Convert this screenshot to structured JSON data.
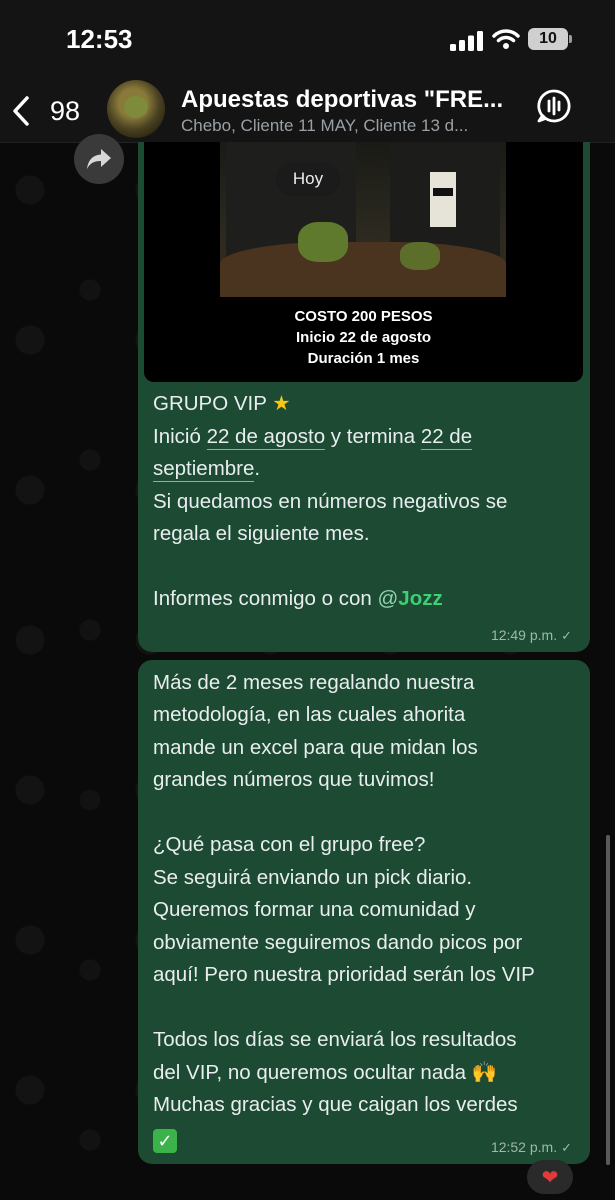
{
  "status_bar": {
    "time": "12:53",
    "battery": "10"
  },
  "header": {
    "back_count": "98",
    "title": "Apuestas deportivas  \"FRE...",
    "subtitle": "Chebo, Cliente 11 MAY, Cliente 13 d..."
  },
  "day_divider": "Hoy",
  "message1": {
    "media_lines": [
      "COSTO 200 PESOS",
      "Inicio 22 de agosto",
      "Duración 1 mes"
    ],
    "line1": "GRUPO VIP",
    "line1_emoji": "★",
    "line2_pre": "Inició ",
    "line2_link1": "22 de agosto",
    "line2_mid": " y termina ",
    "line2_link2": "22 de",
    "line3_link": "septiembre",
    "line3_post": ".",
    "line4": "Si quedamos en números negativos se",
    "line5": "regala el siguiente mes.",
    "line6_pre": "Informes conmigo o con ",
    "mention_at": "@",
    "mention_name": "Jozz",
    "time": "12:49 p.m.",
    "status_icon": "✓"
  },
  "message2": {
    "lines": [
      "Más de 2 meses regalando nuestra",
      "metodología, en las cuales ahorita",
      "mande un excel para que midan los",
      "grandes números que tuvimos!",
      "",
      "¿Qué pasa con el grupo free?",
      "Se seguirá enviando un pick diario.",
      "Queremos formar una comunidad y",
      "obviamente seguiremos dando picos por",
      "aquí! Pero nuestra prioridad serán los VIP",
      "",
      "Todos los días se enviará los resultados",
      "del VIP, no queremos ocultar nada 🙌",
      "Muchas gracias y que caigan los verdes"
    ],
    "last_emoji": "✓",
    "time": "12:52 p.m.",
    "status_icon": "✓"
  },
  "reaction": "❤"
}
